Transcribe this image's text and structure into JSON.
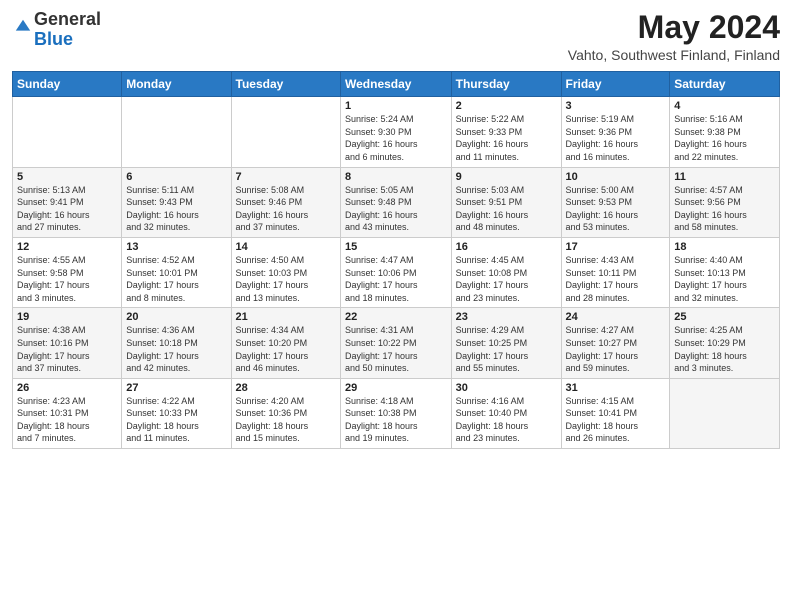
{
  "header": {
    "logo_general": "General",
    "logo_blue": "Blue",
    "title": "May 2024",
    "location": "Vahto, Southwest Finland, Finland"
  },
  "days_of_week": [
    "Sunday",
    "Monday",
    "Tuesday",
    "Wednesday",
    "Thursday",
    "Friday",
    "Saturday"
  ],
  "weeks": [
    [
      {
        "day": "",
        "info": ""
      },
      {
        "day": "",
        "info": ""
      },
      {
        "day": "",
        "info": ""
      },
      {
        "day": "1",
        "info": "Sunrise: 5:24 AM\nSunset: 9:30 PM\nDaylight: 16 hours\nand 6 minutes."
      },
      {
        "day": "2",
        "info": "Sunrise: 5:22 AM\nSunset: 9:33 PM\nDaylight: 16 hours\nand 11 minutes."
      },
      {
        "day": "3",
        "info": "Sunrise: 5:19 AM\nSunset: 9:36 PM\nDaylight: 16 hours\nand 16 minutes."
      },
      {
        "day": "4",
        "info": "Sunrise: 5:16 AM\nSunset: 9:38 PM\nDaylight: 16 hours\nand 22 minutes."
      }
    ],
    [
      {
        "day": "5",
        "info": "Sunrise: 5:13 AM\nSunset: 9:41 PM\nDaylight: 16 hours\nand 27 minutes."
      },
      {
        "day": "6",
        "info": "Sunrise: 5:11 AM\nSunset: 9:43 PM\nDaylight: 16 hours\nand 32 minutes."
      },
      {
        "day": "7",
        "info": "Sunrise: 5:08 AM\nSunset: 9:46 PM\nDaylight: 16 hours\nand 37 minutes."
      },
      {
        "day": "8",
        "info": "Sunrise: 5:05 AM\nSunset: 9:48 PM\nDaylight: 16 hours\nand 43 minutes."
      },
      {
        "day": "9",
        "info": "Sunrise: 5:03 AM\nSunset: 9:51 PM\nDaylight: 16 hours\nand 48 minutes."
      },
      {
        "day": "10",
        "info": "Sunrise: 5:00 AM\nSunset: 9:53 PM\nDaylight: 16 hours\nand 53 minutes."
      },
      {
        "day": "11",
        "info": "Sunrise: 4:57 AM\nSunset: 9:56 PM\nDaylight: 16 hours\nand 58 minutes."
      }
    ],
    [
      {
        "day": "12",
        "info": "Sunrise: 4:55 AM\nSunset: 9:58 PM\nDaylight: 17 hours\nand 3 minutes."
      },
      {
        "day": "13",
        "info": "Sunrise: 4:52 AM\nSunset: 10:01 PM\nDaylight: 17 hours\nand 8 minutes."
      },
      {
        "day": "14",
        "info": "Sunrise: 4:50 AM\nSunset: 10:03 PM\nDaylight: 17 hours\nand 13 minutes."
      },
      {
        "day": "15",
        "info": "Sunrise: 4:47 AM\nSunset: 10:06 PM\nDaylight: 17 hours\nand 18 minutes."
      },
      {
        "day": "16",
        "info": "Sunrise: 4:45 AM\nSunset: 10:08 PM\nDaylight: 17 hours\nand 23 minutes."
      },
      {
        "day": "17",
        "info": "Sunrise: 4:43 AM\nSunset: 10:11 PM\nDaylight: 17 hours\nand 28 minutes."
      },
      {
        "day": "18",
        "info": "Sunrise: 4:40 AM\nSunset: 10:13 PM\nDaylight: 17 hours\nand 32 minutes."
      }
    ],
    [
      {
        "day": "19",
        "info": "Sunrise: 4:38 AM\nSunset: 10:16 PM\nDaylight: 17 hours\nand 37 minutes."
      },
      {
        "day": "20",
        "info": "Sunrise: 4:36 AM\nSunset: 10:18 PM\nDaylight: 17 hours\nand 42 minutes."
      },
      {
        "day": "21",
        "info": "Sunrise: 4:34 AM\nSunset: 10:20 PM\nDaylight: 17 hours\nand 46 minutes."
      },
      {
        "day": "22",
        "info": "Sunrise: 4:31 AM\nSunset: 10:22 PM\nDaylight: 17 hours\nand 50 minutes."
      },
      {
        "day": "23",
        "info": "Sunrise: 4:29 AM\nSunset: 10:25 PM\nDaylight: 17 hours\nand 55 minutes."
      },
      {
        "day": "24",
        "info": "Sunrise: 4:27 AM\nSunset: 10:27 PM\nDaylight: 17 hours\nand 59 minutes."
      },
      {
        "day": "25",
        "info": "Sunrise: 4:25 AM\nSunset: 10:29 PM\nDaylight: 18 hours\nand 3 minutes."
      }
    ],
    [
      {
        "day": "26",
        "info": "Sunrise: 4:23 AM\nSunset: 10:31 PM\nDaylight: 18 hours\nand 7 minutes."
      },
      {
        "day": "27",
        "info": "Sunrise: 4:22 AM\nSunset: 10:33 PM\nDaylight: 18 hours\nand 11 minutes."
      },
      {
        "day": "28",
        "info": "Sunrise: 4:20 AM\nSunset: 10:36 PM\nDaylight: 18 hours\nand 15 minutes."
      },
      {
        "day": "29",
        "info": "Sunrise: 4:18 AM\nSunset: 10:38 PM\nDaylight: 18 hours\nand 19 minutes."
      },
      {
        "day": "30",
        "info": "Sunrise: 4:16 AM\nSunset: 10:40 PM\nDaylight: 18 hours\nand 23 minutes."
      },
      {
        "day": "31",
        "info": "Sunrise: 4:15 AM\nSunset: 10:41 PM\nDaylight: 18 hours\nand 26 minutes."
      },
      {
        "day": "",
        "info": ""
      }
    ]
  ]
}
